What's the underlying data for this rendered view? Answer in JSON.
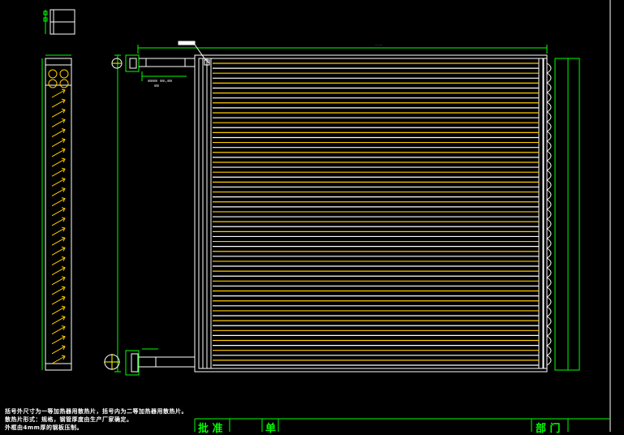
{
  "notes": [
    "括号外尺寸为一等加热器用散热片，括号内为二等加热器用散热片。",
    "散热片形式：规格，钢管厚度由生产厂家确定。",
    "外框由4mm厚的钢板压制。"
  ],
  "title_block": {
    "approve": "批 准",
    "sheet": "单",
    "department": "部 门"
  },
  "colors": {
    "background": "#000000",
    "outline": "#ffffff",
    "fins": "#ffcc00",
    "dimension": "#00ff00"
  },
  "fin_count": 62
}
